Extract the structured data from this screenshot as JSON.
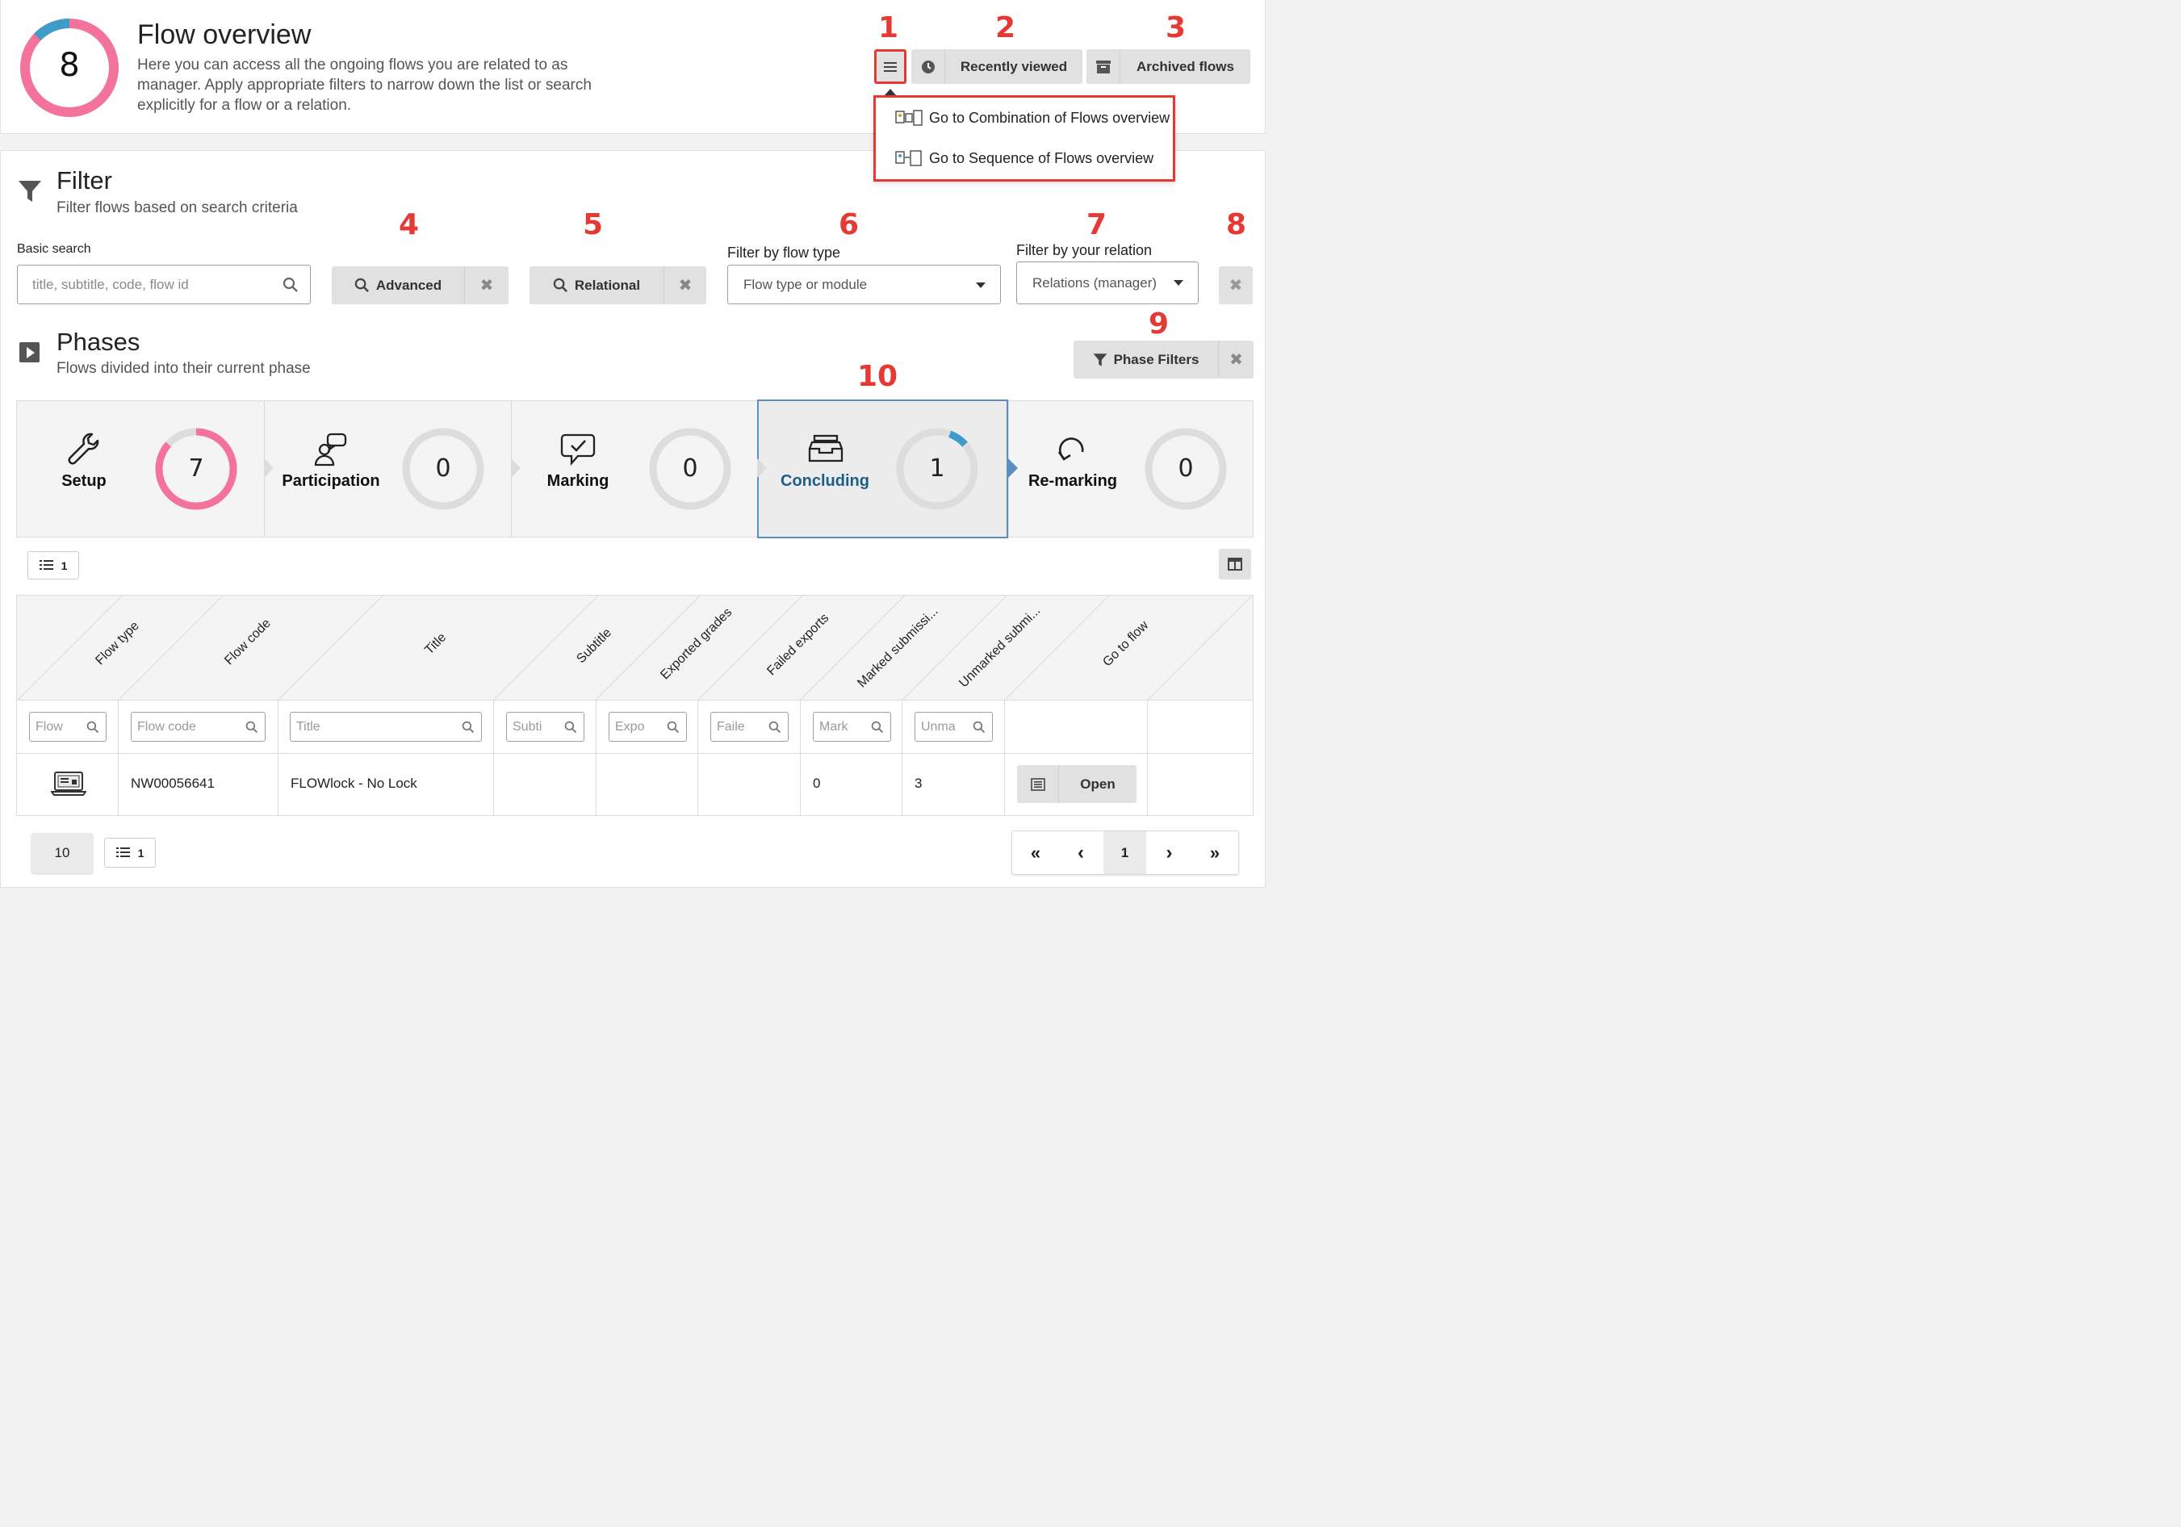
{
  "header": {
    "count": "8",
    "title": "Flow overview",
    "description_line1": "Here you can access all the ongoing flows you are related to as",
    "description_line2": "manager. Apply appropriate filters to narrow down the list or search",
    "description_line3": "explicitly for a flow or a relation.",
    "recently_viewed_label": "Recently viewed",
    "archived_flows_label": "Archived flows",
    "menu_items": [
      {
        "label": "Go to Combination of Flows overview",
        "icon": "combination-flows-icon"
      },
      {
        "label": "Go to Sequence of Flows overview",
        "icon": "sequence-flows-icon"
      }
    ]
  },
  "annotations": {
    "n1": "1",
    "n2": "2",
    "n3": "3",
    "n4": "4",
    "n5": "5",
    "n6": "6",
    "n7": "7",
    "n8": "8",
    "n9": "9",
    "n10": "10",
    "color": "#e53935"
  },
  "filter": {
    "title": "Filter",
    "subtitle": "Filter flows based on search criteria",
    "basic_search_label": "Basic search",
    "basic_search_placeholder": "title, subtitle, code, flow id",
    "advanced_label": "Advanced",
    "relational_label": "Relational",
    "flow_type_label": "Filter by flow type",
    "flow_type_value": "Flow type or module",
    "relation_label": "Filter by your relation",
    "relation_value": "Relations (manager)"
  },
  "phases": {
    "title": "Phases",
    "subtitle": "Flows divided into their current phase",
    "phase_filters_label": "Phase Filters",
    "items": [
      {
        "label": "Setup",
        "count": "7",
        "icon": "wrench-icon"
      },
      {
        "label": "Participation",
        "count": "0",
        "icon": "participation-icon"
      },
      {
        "label": "Marking",
        "count": "0",
        "icon": "speech-check-icon"
      },
      {
        "label": "Concluding",
        "count": "1",
        "icon": "inbox-icon",
        "active": true
      },
      {
        "label": "Re-marking",
        "count": "0",
        "icon": "redo-icon"
      }
    ]
  },
  "table": {
    "rows_count_badge": "1",
    "columns": [
      "Flow type",
      "Flow code",
      "Title",
      "Subtitle",
      "Exported grades",
      "Failed exports",
      "Marked submissi...",
      "Unmarked submi...",
      "Go to flow"
    ],
    "filter_placeholders": [
      "Flow",
      "Flow code",
      "Title",
      "Subti",
      "Expo",
      "Faile",
      "Mark",
      "Unma"
    ],
    "rows": [
      {
        "flow_type_icon": "flowlock-laptop-icon",
        "flow_code": "NW00056641",
        "title": "FLOWlock - No Lock",
        "subtitle": "",
        "exported_grades": "",
        "failed_exports": "",
        "marked": "0",
        "unmarked": "3",
        "open_label": "Open"
      }
    ]
  },
  "pagination": {
    "page_size": "10",
    "rows_badge": "1",
    "first": "«",
    "prev": "‹",
    "current": "1",
    "next": "›",
    "last": "»"
  },
  "colors": {
    "pink": "#f4739b",
    "blue": "#3d9dc8",
    "ring_gray": "#dddddd",
    "active_border": "#5a8fc0",
    "active_text": "#1f5d86"
  }
}
